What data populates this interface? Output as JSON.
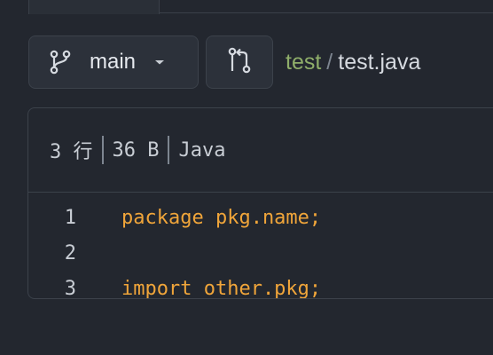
{
  "branch": {
    "name": "main",
    "icon": "git-branch-icon",
    "caret_icon": "chevron-down-icon"
  },
  "compare": {
    "icon": "git-compare-icon"
  },
  "breadcrumb": {
    "repo": "test",
    "separator": "/",
    "file": "test.java"
  },
  "file_meta": {
    "lines": "3 行",
    "size": "36 B",
    "language": "Java"
  },
  "code": {
    "lines": [
      {
        "num": "1",
        "text": "package pkg.name;"
      },
      {
        "num": "2",
        "text": ""
      },
      {
        "num": "3",
        "text": "import other.pkg;"
      }
    ]
  },
  "colors": {
    "background": "#23272f",
    "repo_link": "#8fae6a",
    "code_text": "#f0a53a"
  }
}
